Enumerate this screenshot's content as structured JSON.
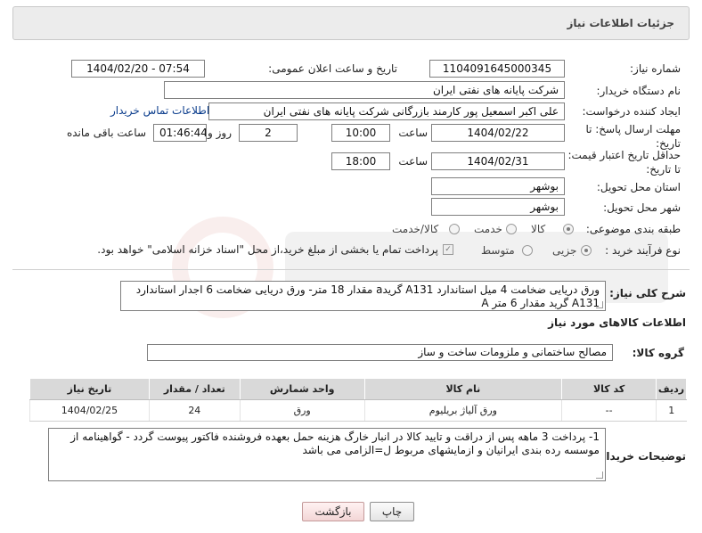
{
  "header": {
    "title": "جزئیات اطلاعات نیاز"
  },
  "fields": {
    "need_number": {
      "label": "شماره نیاز:",
      "value": "1104091645000345"
    },
    "announce_datetime": {
      "label": "تاریخ و ساعت اعلان عمومی:",
      "value": "1404/02/20 - 07:54"
    },
    "buyer_org": {
      "label": "نام دستگاه خریدار:",
      "value": "شرکت پایانه های نفتی ایران"
    },
    "requester": {
      "label": "ایجاد کننده درخواست:",
      "value": "علی اکبر اسمعیل پور کارمند بازرگانی شرکت پایانه های نفتی ایران",
      "contact_link": "اطلاعات تماس خریدار"
    },
    "deadline": {
      "label": "مهلت ارسال پاسخ: تا تاریخ:",
      "date": "1404/02/22",
      "time_label": "ساعت",
      "time": "10:00",
      "days": "2",
      "days_label": "روز و",
      "remaining": "01:46:44",
      "remaining_label": "ساعت باقی مانده"
    },
    "price_validity": {
      "label": "حداقل تاریخ اعتبار قیمت: تا تاریخ:",
      "date": "1404/02/31",
      "time_label": "ساعت",
      "time": "18:00"
    },
    "province": {
      "label": "استان محل تحویل:",
      "value": "بوشهر"
    },
    "city": {
      "label": "شهر محل تحویل:",
      "value": "بوشهر"
    },
    "category": {
      "label": "طبقه بندی موضوعی:",
      "options": [
        "کالا",
        "خدمت",
        "کالا/خدمت"
      ],
      "selected": "کالا"
    },
    "process": {
      "label": "نوع فرآیند خرید :",
      "options": [
        "جزیی",
        "متوسط"
      ],
      "selected": "جزیی",
      "payment_note": "پرداخت تمام یا بخشی از مبلغ خرید،از محل \"اسناد خزانه اسلامی\" خواهد بود."
    }
  },
  "description": {
    "label": "شرح کلی نیاز:",
    "text": "ورق دریایی ضخامت 4 میل استاندارد A131 گریدa مقدار 18 متر- ورق دریایی ضخامت 6  اجدار استاندارد A131 گرید  مقدار 6 متر A"
  },
  "goods_section": {
    "title": "اطلاعات کالاهای مورد نیاز",
    "group_label": "گروه کالا:",
    "group_value": "مصالح ساختمانی و ملزومات ساخت و ساز"
  },
  "table": {
    "headers": [
      "ردیف",
      "کد کالا",
      "نام کالا",
      "واحد شمارش",
      "تعداد / مقدار",
      "تاریخ نیاز"
    ],
    "rows": [
      [
        "1",
        "--",
        "ورق آلیاژ بریلیوم",
        "ورق",
        "24",
        "1404/02/25"
      ]
    ]
  },
  "buyer_notes": {
    "label": "توضیحات خریدار:",
    "text": "1- پرداخت 3 ماهه پس از دراقت و تایید کالا در انبار خارگ هزینه حمل بعهده فروشنده فاکتور پیوست گردد  - گواهینامه از موسسه رده بندی ایرانیان و ازمایشهای مربوط ل=الزامی می باشد"
  },
  "buttons": {
    "print": "چاپ",
    "back": "بازگشت"
  }
}
